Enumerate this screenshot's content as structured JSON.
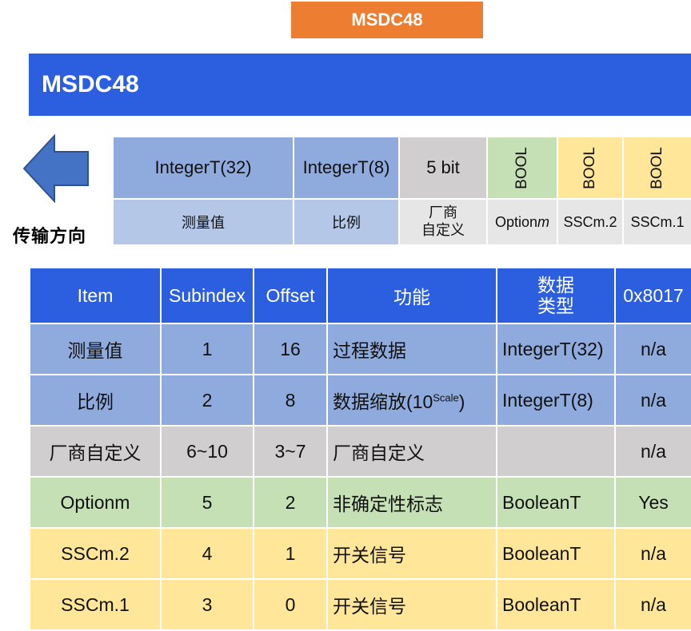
{
  "top_tag": "MSDC48",
  "banner_title": "MSDC48",
  "direction_label": "传输方向",
  "icons": {
    "arrow": "left-arrow-icon"
  },
  "frame": {
    "top": {
      "measured": "IntegerT(32)",
      "scale": "IntegerT(8)",
      "vendor": "5 bit",
      "optionm": "BOOL",
      "sscm2": "BOOL",
      "sscm1": "BOOL"
    },
    "bottom": {
      "measured": "测量值",
      "scale": "比例",
      "vendor_line1": "厂商",
      "vendor_line2": "自定义",
      "optionm_prefix": "Option",
      "optionm_suffix": "m",
      "sscm2": "SSCm.2",
      "sscm1": "SSCm.1"
    }
  },
  "table": {
    "headers": {
      "item": "Item",
      "subindex": "Subindex",
      "offset": "Offset",
      "function": "功能",
      "type_line1": "数据",
      "type_line2": "类型",
      "code": "0x8017"
    },
    "rows": [
      {
        "item": "测量值",
        "subindex": "1",
        "offset": "16",
        "function": "过程数据",
        "type": "IntegerT(32)",
        "code": "n/a"
      },
      {
        "item": "比例",
        "subindex": "2",
        "offset": "8",
        "function": "数据缩放(10",
        "function_sup": "Scale",
        "function_tail": ")",
        "type": "IntegerT(8)",
        "code": "n/a"
      },
      {
        "item": "厂商自定义",
        "subindex": "6~10",
        "offset": "3~7",
        "function": "厂商自定义",
        "type": "",
        "code": "n/a"
      },
      {
        "item": "Optionm",
        "subindex": "5",
        "offset": "2",
        "function": "非确定性标志",
        "type": "BooleanT",
        "code": "Yes"
      },
      {
        "item": "SSCm.2",
        "subindex": "4",
        "offset": "1",
        "function": "开关信号",
        "type": "BooleanT",
        "code": "n/a"
      },
      {
        "item": "SSCm.1",
        "subindex": "3",
        "offset": "0",
        "function": "开关信号",
        "type": "BooleanT",
        "code": "n/a"
      }
    ]
  },
  "colors": {
    "orange": "#ed7d31",
    "blue_header": "#2b5fe0",
    "blue_row": "#8faadc",
    "gray_row": "#d0cece",
    "green_row": "#c5e0b4",
    "yellow_row": "#ffe699"
  }
}
